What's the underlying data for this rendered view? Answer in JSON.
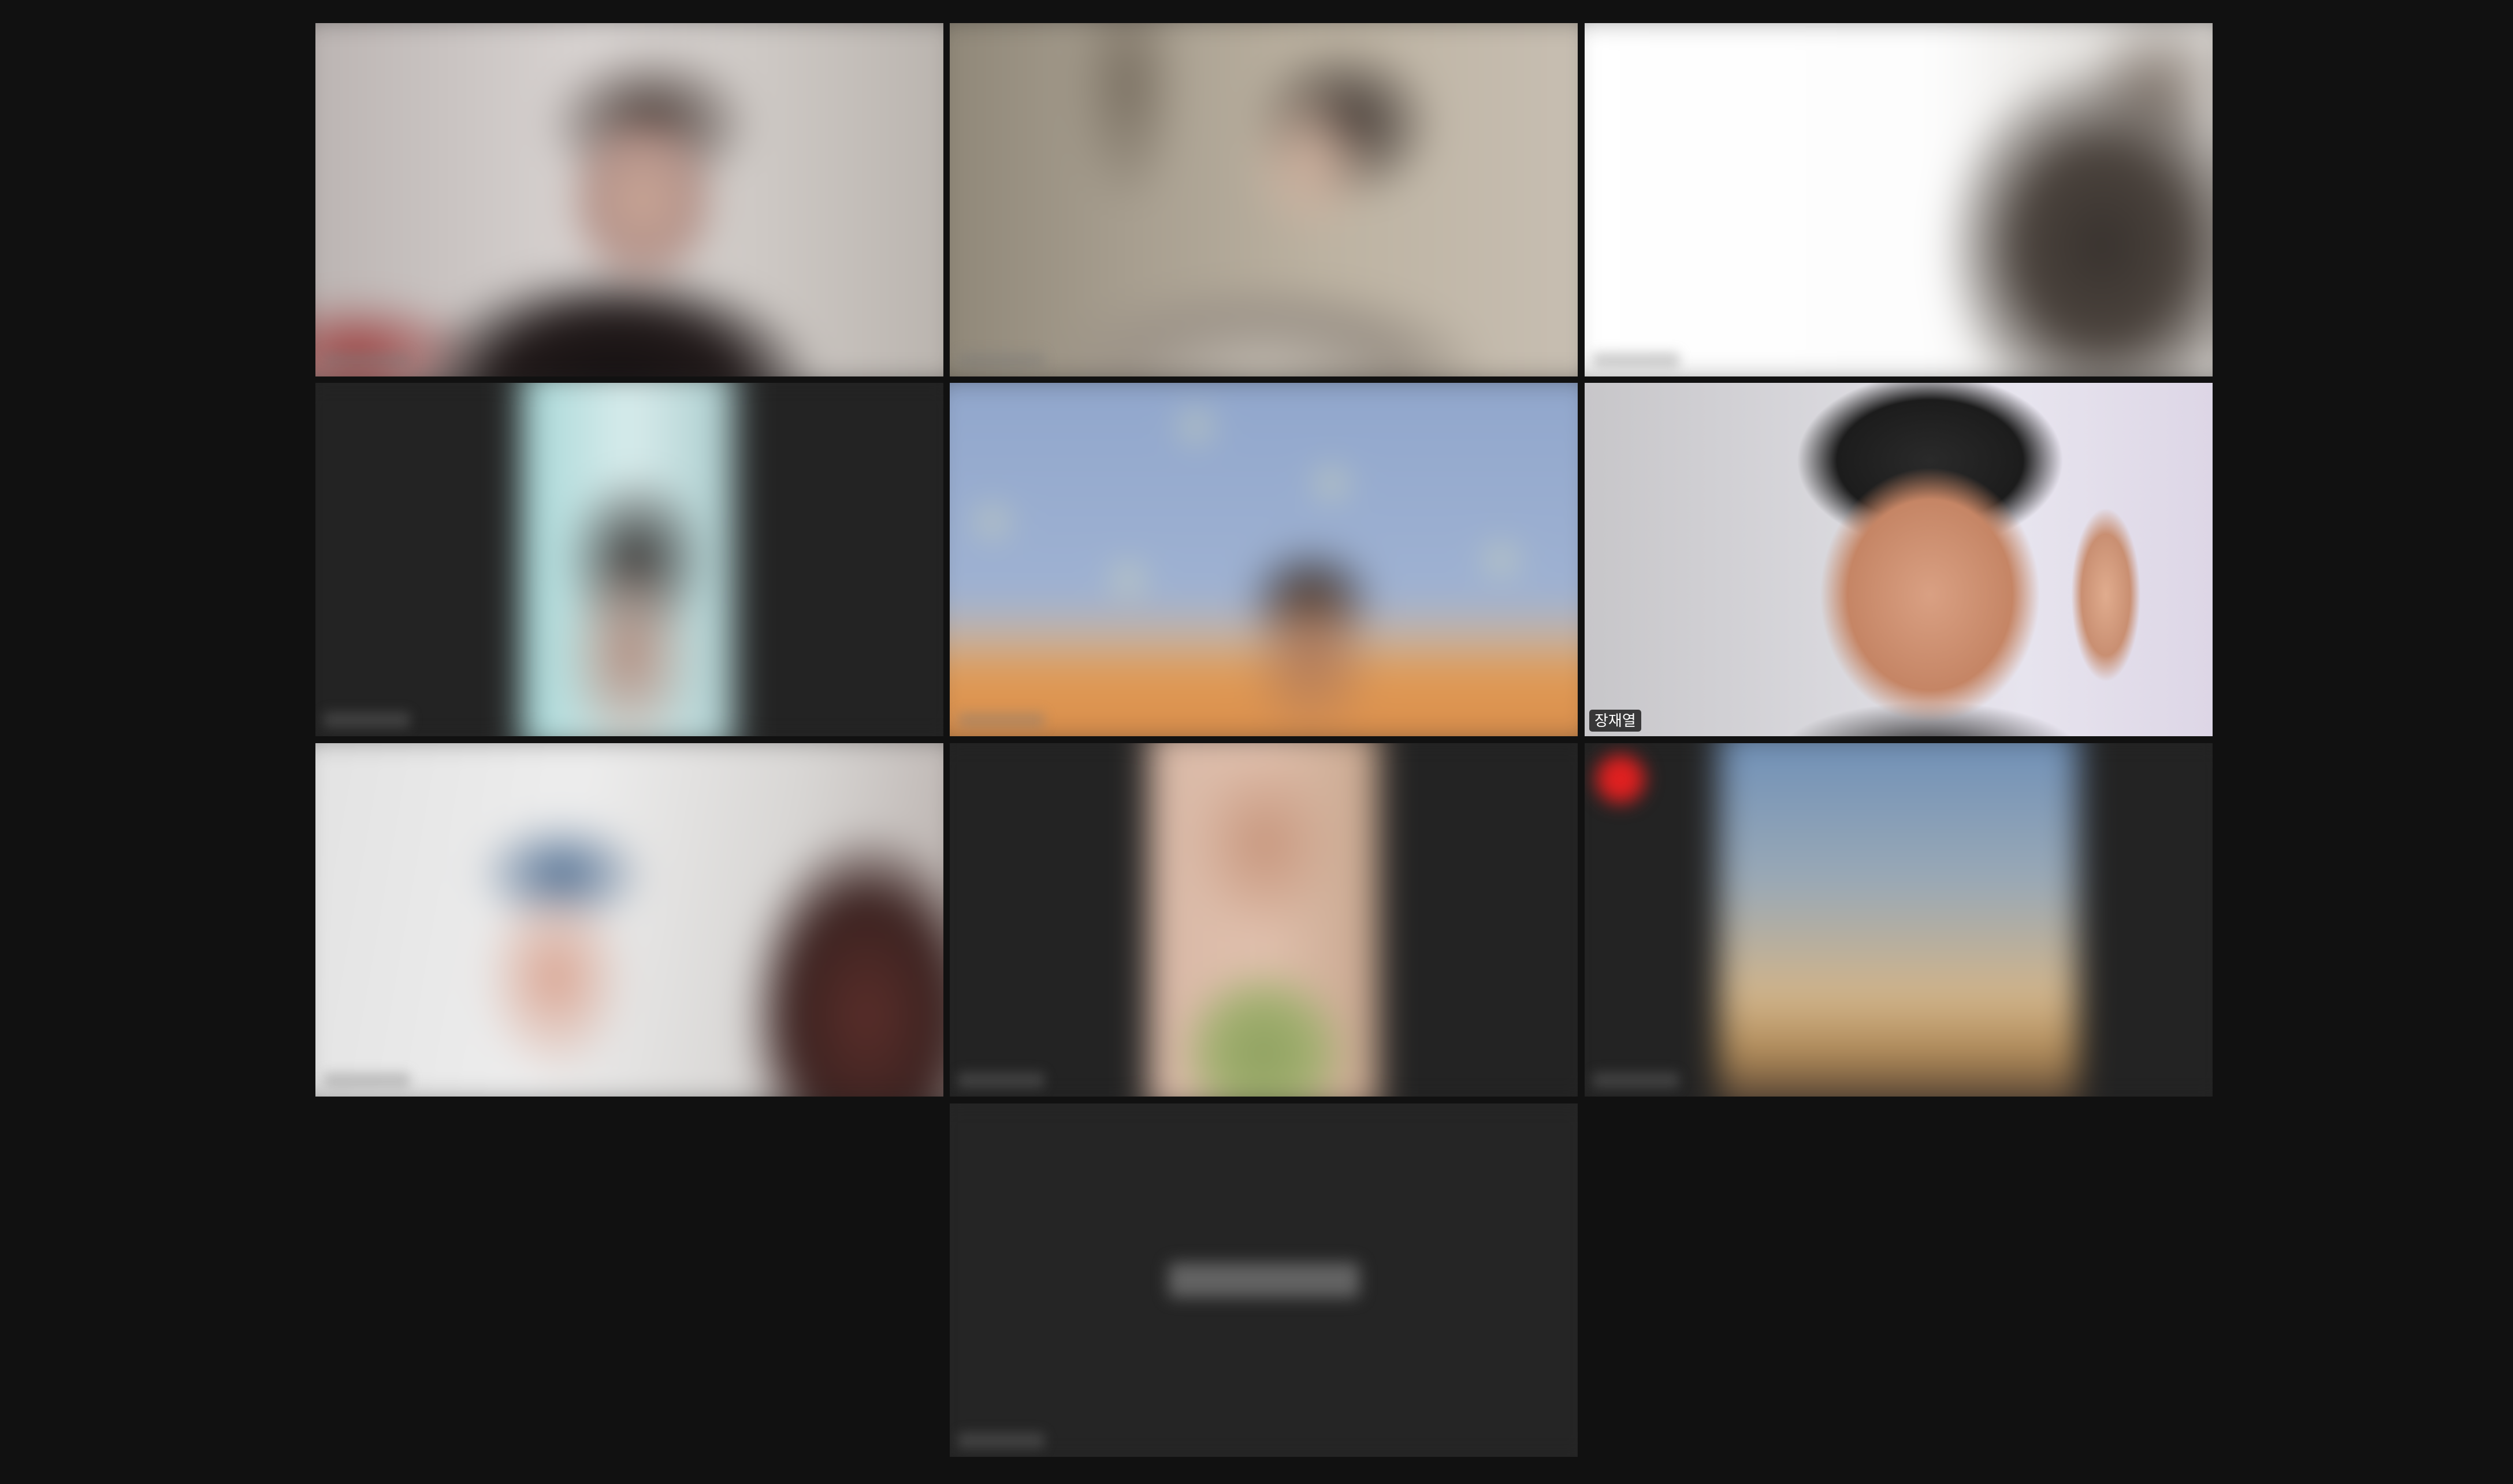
{
  "app": {
    "view": "gallery"
  },
  "participants": [
    {
      "name": ""
    },
    {
      "name": ""
    },
    {
      "name": ""
    },
    {
      "name": ""
    },
    {
      "name": ""
    },
    {
      "name": "장재열"
    },
    {
      "name": ""
    },
    {
      "name": ""
    },
    {
      "name": ""
    },
    {
      "name": ""
    }
  ]
}
